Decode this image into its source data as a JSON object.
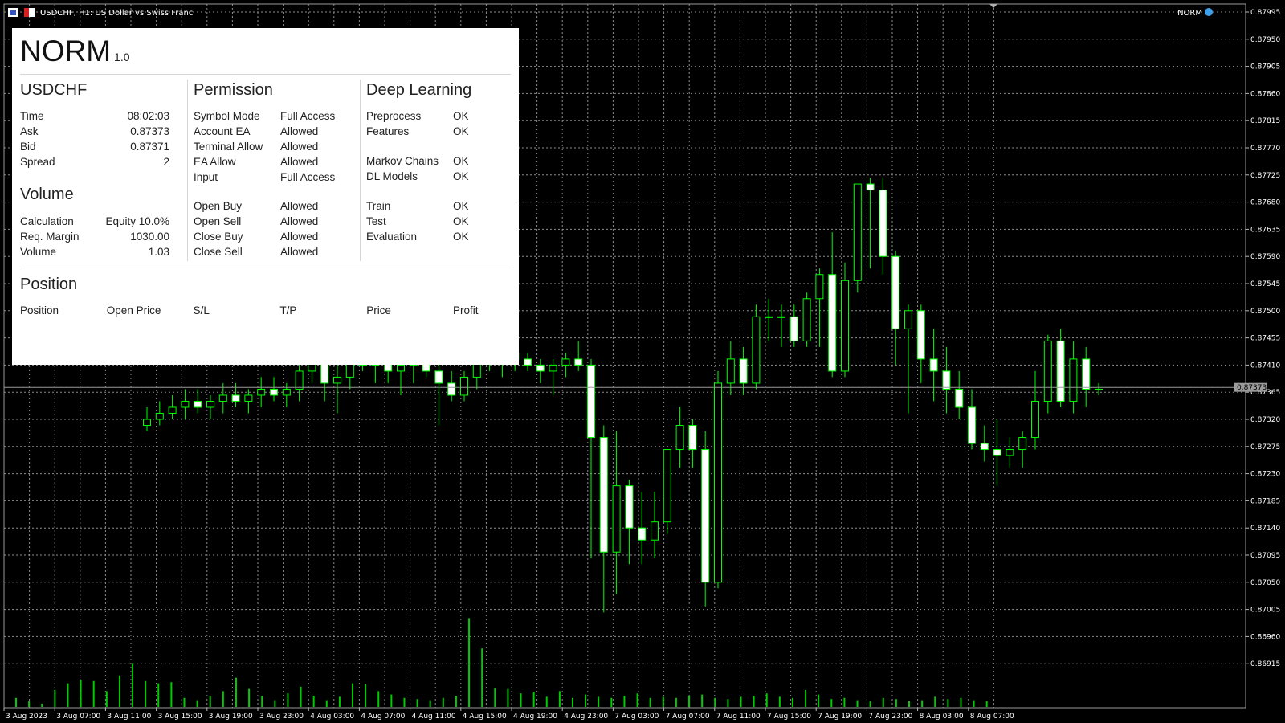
{
  "chart": {
    "header_symbol": "USDCHF, H1:  US Dollar vs Swiss Franc",
    "expert_label": "NORM",
    "current_price_label": "0.87373",
    "price_ticks": [
      "0.87995",
      "0.87950",
      "0.87905",
      "0.87860",
      "0.87815",
      "0.87770",
      "0.87725",
      "0.87680",
      "0.87635",
      "0.87590",
      "0.87545",
      "0.87500",
      "0.87455",
      "0.87410",
      "0.87365",
      "0.87320",
      "0.87275",
      "0.87230",
      "0.87185",
      "0.87140",
      "0.87095",
      "0.87050",
      "0.87005",
      "0.86960",
      "0.86915"
    ],
    "time_ticks": [
      "3 Aug 2023",
      "3 Aug 07:00",
      "3 Aug 11:00",
      "3 Aug 15:00",
      "3 Aug 19:00",
      "3 Aug 23:00",
      "4 Aug 03:00",
      "4 Aug 07:00",
      "4 Aug 11:00",
      "4 Aug 15:00",
      "4 Aug 19:00",
      "4 Aug 23:00",
      "7 Aug 03:00",
      "7 Aug 07:00",
      "7 Aug 11:00",
      "7 Aug 15:00",
      "7 Aug 19:00",
      "7 Aug 23:00",
      "8 Aug 03:00",
      "8 Aug 07:00"
    ],
    "colors": {
      "background": "#000000",
      "grid": "#8c8c8c",
      "bull_fill": "#000000",
      "bear_fill": "#ffffff",
      "wick": "#00ff00",
      "volume": "#00cc00",
      "axis_text": "#ffffff"
    },
    "candles": [
      [
        0.8731,
        0.8734,
        0.873,
        0.8732
      ],
      [
        0.8732,
        0.8735,
        0.8731,
        0.8733
      ],
      [
        0.8733,
        0.8736,
        0.8732,
        0.8734
      ],
      [
        0.8734,
        0.8737,
        0.8732,
        0.8735
      ],
      [
        0.8735,
        0.8737,
        0.8733,
        0.8734
      ],
      [
        0.8734,
        0.8736,
        0.8732,
        0.8735
      ],
      [
        0.8735,
        0.8738,
        0.8733,
        0.8736
      ],
      [
        0.8736,
        0.8738,
        0.8734,
        0.8735
      ],
      [
        0.8735,
        0.8737,
        0.8733,
        0.8736
      ],
      [
        0.8736,
        0.8739,
        0.8734,
        0.8737
      ],
      [
        0.8737,
        0.8739,
        0.8735,
        0.8736
      ],
      [
        0.8736,
        0.8738,
        0.8734,
        0.8737
      ],
      [
        0.8737,
        0.8742,
        0.8735,
        0.874
      ],
      [
        0.874,
        0.8744,
        0.8738,
        0.8743
      ],
      [
        0.8743,
        0.8745,
        0.8735,
        0.8738
      ],
      [
        0.8738,
        0.8741,
        0.8733,
        0.8739
      ],
      [
        0.8739,
        0.8745,
        0.8737,
        0.8744
      ],
      [
        0.8744,
        0.8746,
        0.874,
        0.8741
      ],
      [
        0.8741,
        0.8745,
        0.8738,
        0.8744
      ],
      [
        0.8744,
        0.8746,
        0.8738,
        0.874
      ],
      [
        0.874,
        0.8742,
        0.8736,
        0.8741
      ],
      [
        0.8741,
        0.8744,
        0.8738,
        0.8743
      ],
      [
        0.8743,
        0.8745,
        0.8739,
        0.874
      ],
      [
        0.874,
        0.8742,
        0.8731,
        0.8738
      ],
      [
        0.8738,
        0.874,
        0.8735,
        0.8736
      ],
      [
        0.8736,
        0.874,
        0.8735,
        0.8739
      ],
      [
        0.8739,
        0.8743,
        0.8737,
        0.8742
      ],
      [
        0.8742,
        0.8744,
        0.874,
        0.8742
      ],
      [
        0.8742,
        0.8745,
        0.8739,
        0.8743
      ],
      [
        0.8743,
        0.8744,
        0.874,
        0.8742
      ],
      [
        0.8742,
        0.8743,
        0.874,
        0.8741
      ],
      [
        0.8741,
        0.8742,
        0.8738,
        0.874
      ],
      [
        0.874,
        0.8742,
        0.8736,
        0.8741
      ],
      [
        0.8741,
        0.8743,
        0.8739,
        0.8742
      ],
      [
        0.8742,
        0.8745,
        0.874,
        0.8741
      ],
      [
        0.8741,
        0.8742,
        0.8709,
        0.8729
      ],
      [
        0.8729,
        0.8731,
        0.87,
        0.871
      ],
      [
        0.871,
        0.873,
        0.8703,
        0.8721
      ],
      [
        0.8721,
        0.8722,
        0.8708,
        0.8714
      ],
      [
        0.8714,
        0.872,
        0.8708,
        0.8712
      ],
      [
        0.8712,
        0.872,
        0.8709,
        0.8715
      ],
      [
        0.8715,
        0.8726,
        0.8713,
        0.8727
      ],
      [
        0.8727,
        0.8734,
        0.8724,
        0.8731
      ],
      [
        0.8731,
        0.8732,
        0.8724,
        0.8727
      ],
      [
        0.8727,
        0.873,
        0.8701,
        0.8705
      ],
      [
        0.8705,
        0.874,
        0.8704,
        0.8738
      ],
      [
        0.8738,
        0.8745,
        0.8736,
        0.8742
      ],
      [
        0.8742,
        0.8744,
        0.8736,
        0.8738
      ],
      [
        0.8738,
        0.8751,
        0.8737,
        0.8749
      ],
      [
        0.8749,
        0.8752,
        0.8745,
        0.8749
      ],
      [
        0.8749,
        0.8751,
        0.8744,
        0.8749
      ],
      [
        0.8749,
        0.8751,
        0.8744,
        0.8745
      ],
      [
        0.8745,
        0.8753,
        0.8744,
        0.8752
      ],
      [
        0.8752,
        0.8757,
        0.8744,
        0.8756
      ],
      [
        0.8756,
        0.8763,
        0.8739,
        0.874
      ],
      [
        0.874,
        0.8758,
        0.8739,
        0.8755
      ],
      [
        0.8755,
        0.8768,
        0.8753,
        0.8771
      ],
      [
        0.8771,
        0.8772,
        0.8757,
        0.877
      ],
      [
        0.877,
        0.8772,
        0.8756,
        0.8759
      ],
      [
        0.8759,
        0.876,
        0.8741,
        0.8747
      ],
      [
        0.8747,
        0.8751,
        0.8733,
        0.875
      ],
      [
        0.875,
        0.8751,
        0.8738,
        0.8742
      ],
      [
        0.8742,
        0.8747,
        0.8735,
        0.874
      ],
      [
        0.874,
        0.8744,
        0.8733,
        0.8737
      ],
      [
        0.8737,
        0.874,
        0.8732,
        0.8734
      ],
      [
        0.8734,
        0.8737,
        0.8727,
        0.8728
      ],
      [
        0.8728,
        0.8731,
        0.8725,
        0.8727
      ],
      [
        0.8727,
        0.8732,
        0.8721,
        0.8726
      ],
      [
        0.8726,
        0.8729,
        0.8724,
        0.8727
      ],
      [
        0.8727,
        0.873,
        0.8724,
        0.8729
      ],
      [
        0.8729,
        0.874,
        0.8727,
        0.8735
      ],
      [
        0.8735,
        0.8746,
        0.8733,
        0.8745
      ],
      [
        0.8745,
        0.8747,
        0.8734,
        0.8735
      ],
      [
        0.8735,
        0.8745,
        0.8733,
        0.8742
      ],
      [
        0.8742,
        0.8744,
        0.8734,
        0.8737
      ],
      [
        0.8737,
        0.8738,
        0.8736,
        0.8737
      ]
    ],
    "volumes": [
      8,
      5,
      3,
      15,
      21,
      24,
      23,
      14,
      28,
      39,
      23,
      21,
      22,
      8,
      6,
      10,
      14,
      26,
      16,
      10,
      6,
      12,
      18,
      10,
      6,
      9,
      21,
      20,
      14,
      11,
      8,
      7,
      6,
      8,
      10,
      79,
      52,
      17,
      16,
      12,
      13,
      9,
      14,
      8,
      11,
      9,
      8,
      10,
      12,
      8,
      9,
      8,
      10,
      11,
      8,
      7,
      9,
      10,
      12,
      9,
      8,
      15,
      11,
      7,
      8,
      6,
      5,
      8,
      7,
      5,
      6,
      9,
      7,
      8,
      6,
      5
    ]
  },
  "panel": {
    "app_name": "NORM",
    "app_version": "1.0",
    "symbol": {
      "title": "USDCHF",
      "rows": [
        {
          "label": "Time",
          "value": "08:02:03"
        },
        {
          "label": "Ask",
          "value": "0.87373"
        },
        {
          "label": "Bid",
          "value": "0.87371"
        },
        {
          "label": "Spread",
          "value": "2"
        }
      ]
    },
    "volume": {
      "title": "Volume",
      "rows": [
        {
          "label": "Calculation",
          "value": "Equity 10.0%"
        },
        {
          "label": "Req. Margin",
          "value": "1030.00"
        },
        {
          "label": "Volume",
          "value": "1.03"
        }
      ]
    },
    "permission": {
      "title": "Permission",
      "rows_a": [
        {
          "label": "Symbol Mode",
          "value": "Full Access"
        },
        {
          "label": "Account EA",
          "value": "Allowed"
        },
        {
          "label": "Terminal Allow",
          "value": "Allowed"
        },
        {
          "label": "EA Allow",
          "value": "Allowed"
        },
        {
          "label": "Input",
          "value": "Full Access"
        }
      ],
      "rows_b": [
        {
          "label": "Open Buy",
          "value": "Allowed"
        },
        {
          "label": "Open Sell",
          "value": "Allowed"
        },
        {
          "label": "Close Buy",
          "value": "Allowed"
        },
        {
          "label": "Close Sell",
          "value": "Allowed"
        }
      ]
    },
    "deep_learning": {
      "title": "Deep Learning",
      "rows_a": [
        {
          "label": "Preprocess",
          "value": "OK"
        },
        {
          "label": "Features",
          "value": "OK"
        }
      ],
      "rows_b": [
        {
          "label": "Markov Chains",
          "value": "OK"
        },
        {
          "label": "DL Models",
          "value": "OK"
        }
      ],
      "rows_c": [
        {
          "label": "Train",
          "value": "OK"
        },
        {
          "label": "Test",
          "value": "OK"
        },
        {
          "label": "Evaluation",
          "value": "OK"
        }
      ]
    },
    "position": {
      "title": "Position",
      "columns": [
        "Position",
        "Open Price",
        "S/L",
        "T/P",
        "Price",
        "Profit"
      ]
    }
  }
}
